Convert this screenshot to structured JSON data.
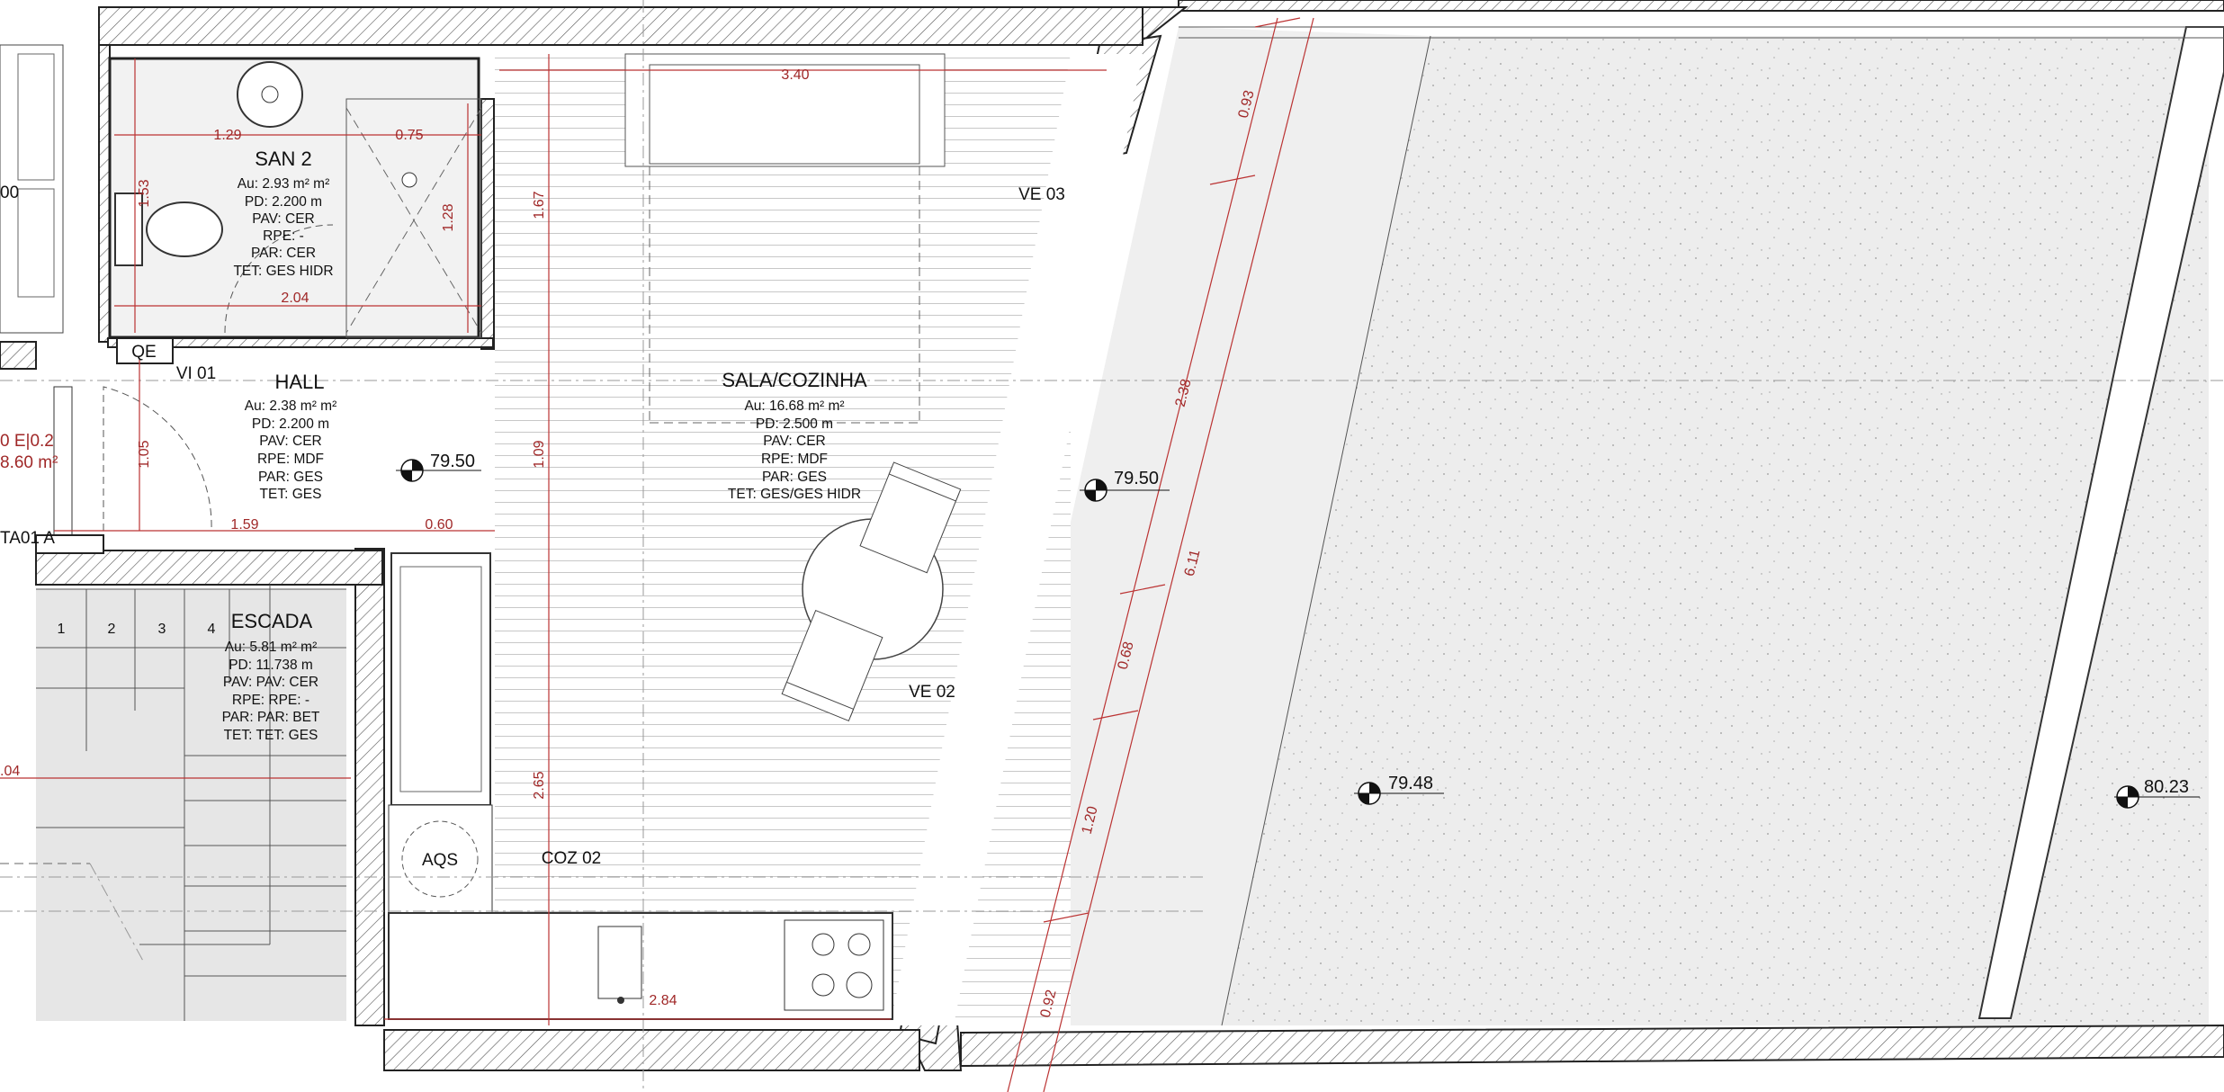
{
  "colors": {
    "dimension": "#a02828",
    "wall_line": "#222222",
    "terrace_fill": "#ececec",
    "ink": "#111111"
  },
  "rooms": {
    "san2": {
      "name": "SAN 2",
      "specs": [
        "Au: 2.93 m² m²",
        "PD: 2.200 m",
        "PAV: CER",
        "RPE: -",
        "PAR: CER",
        "TET: GES HIDR"
      ]
    },
    "hall": {
      "name": "HALL",
      "specs": [
        "Au: 2.38 m² m²",
        "PD: 2.200 m",
        "PAV: CER",
        "RPE: MDF",
        "PAR: GES",
        "TET: GES"
      ]
    },
    "sala": {
      "name": "SALA/COZINHA",
      "specs": [
        "Au: 16.68 m² m²",
        "PD: 2.500 m",
        "PAV: CER",
        "RPE: MDF",
        "PAR: GES",
        "TET: GES/GES HIDR"
      ]
    },
    "escada": {
      "name": "ESCADA",
      "specs": [
        "Au: 5.81 m² m²",
        "PD: 11.738 m",
        "PAV: PAV: CER",
        "RPE: RPE: -",
        "PAR: PAR: BET",
        "TET: TET: GES"
      ]
    }
  },
  "levels": {
    "hall": "79.50",
    "terrace_upper": "79.50",
    "terrace_lower": "79.48",
    "exterior": "80.23"
  },
  "labels": {
    "qe": "QE",
    "vi01": "VI 01",
    "ve03": "VE 03",
    "ve02": "VE 02",
    "aqs": "AQS",
    "coz02": "COZ 02",
    "ta01a": "TA01 A",
    "left_partial_1": "0 E|0.2",
    "left_partial_2": "8.60 m²",
    "left_partial_3": "00"
  },
  "stair_steps": [
    "1",
    "2",
    "3",
    "4"
  ],
  "dimensions": {
    "san_width": "1.29",
    "shower_width": "0.75",
    "san_height": "1.53",
    "shower_height": "1.28",
    "san_bottom": "2.04",
    "hall_height": "1.05",
    "hall_width": "1.59",
    "passage": "0.60",
    "sala_width_top": "3.40",
    "sala_h1": "1.67",
    "sala_h2": "1.09",
    "sala_h3": "2.65",
    "kitchen_width": "2.84",
    "escada_left": ".04",
    "terr_093": "0.93",
    "terr_238": "2.38",
    "terr_611": "6.11",
    "terr_068": "0.68",
    "terr_120": "1.20",
    "terr_092": "0.92"
  }
}
